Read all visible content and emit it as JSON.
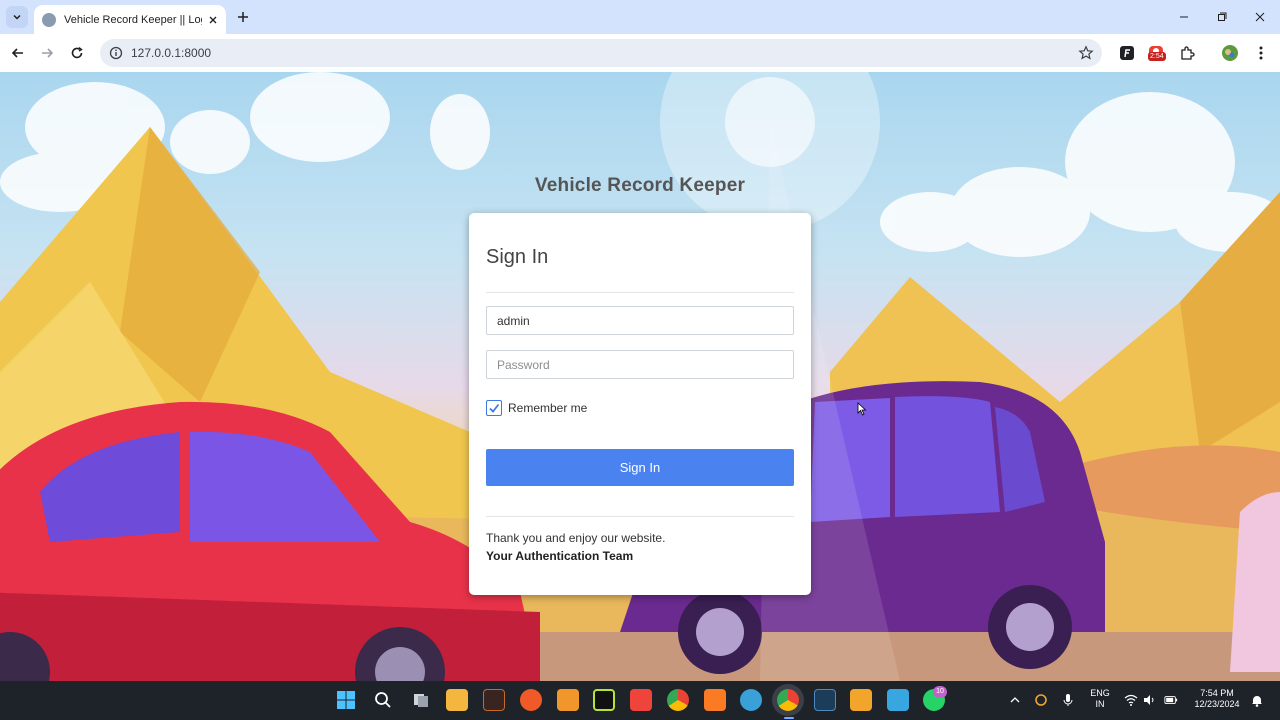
{
  "browser": {
    "tab_title": "Vehicle Record Keeper || Login",
    "url": "127.0.0.1:8000",
    "extension_badge": "2:54"
  },
  "page": {
    "site_title": "Vehicle Record Keeper",
    "form": {
      "heading": "Sign In",
      "username_value": "admin",
      "password_placeholder": "Password",
      "remember_label": "Remember me",
      "remember_checked": true,
      "submit_label": "Sign In"
    },
    "footer": {
      "message": "Thank you and enjoy our website.",
      "signature": "Your Authentication Team"
    }
  },
  "taskbar": {
    "apps": [
      "windows-start",
      "search",
      "task-view",
      "file-explorer",
      "app-tile",
      "app-tile",
      "app-tile",
      "pycharm",
      "anydesk",
      "chrome",
      "xampp",
      "browser",
      "chrome-active",
      "terminal",
      "sublime-text",
      "notepad",
      "whatsapp"
    ],
    "whatsapp_badge": "10",
    "language": "ENG",
    "region": "IN",
    "time": "7:54 PM",
    "date": "12/23/2024"
  },
  "colors": {
    "accent_button": "#4a82f0",
    "tabstrip": "#d3e3fd",
    "taskbar": "#1e2229"
  }
}
